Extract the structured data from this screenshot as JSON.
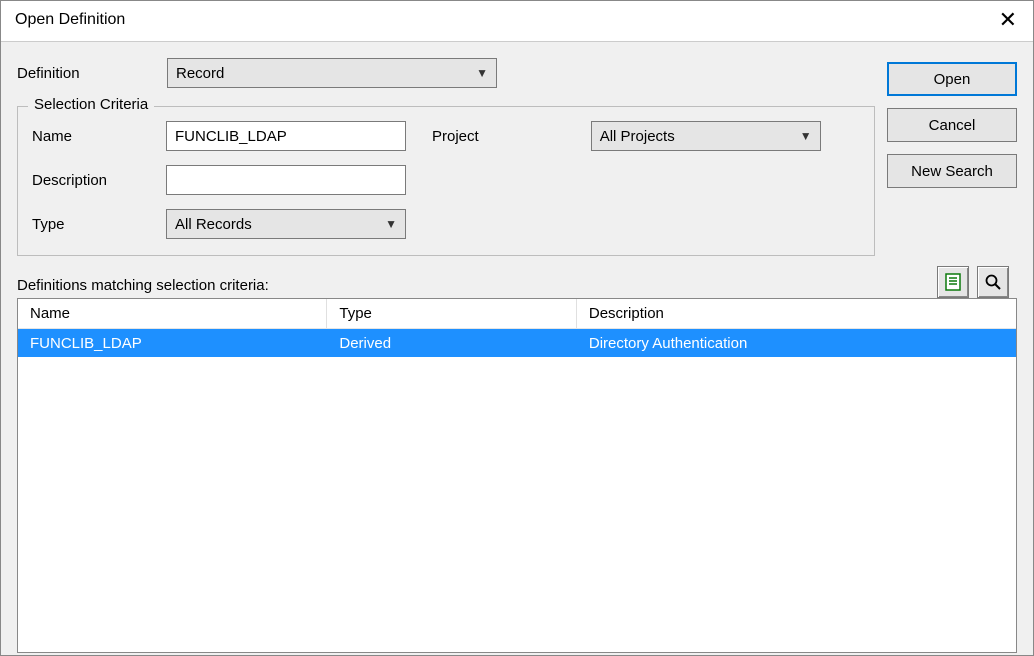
{
  "window": {
    "title": "Open Definition"
  },
  "definition": {
    "label": "Definition",
    "value": "Record"
  },
  "criteria": {
    "legend": "Selection Criteria",
    "name_label": "Name",
    "name_value": "FUNCLIB_LDAP",
    "project_label": "Project",
    "project_value": "All Projects",
    "description_label": "Description",
    "description_value": "",
    "type_label": "Type",
    "type_value": "All Records"
  },
  "buttons": {
    "open": "Open",
    "cancel": "Cancel",
    "new_search": "New Search"
  },
  "list": {
    "label": "Definitions matching selection criteria:",
    "columns": {
      "name": "Name",
      "type": "Type",
      "description": "Description"
    },
    "rows": [
      {
        "name": "FUNCLIB_LDAP",
        "type": "Derived",
        "description": "Directory Authentication",
        "selected": true
      }
    ]
  }
}
